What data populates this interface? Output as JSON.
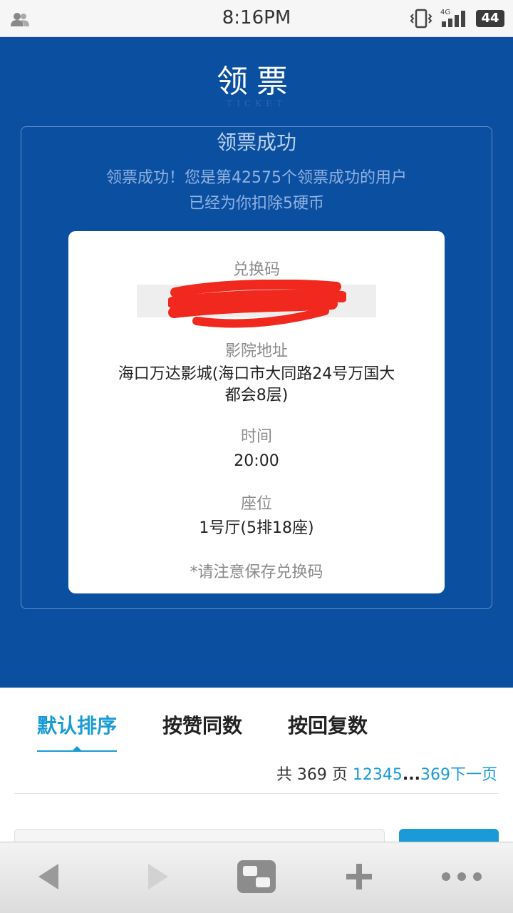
{
  "status_bar": {
    "time": "8:16PM",
    "network": "4G",
    "battery": "44"
  },
  "header": {
    "title": "领票",
    "subtitle": "TICKET"
  },
  "result": {
    "title": "领票成功",
    "message_line1": "领票成功！您是第42575个领票成功的用户",
    "message_line2": "已经为你扣除5硬币"
  },
  "ticket": {
    "code_label": "兑换码",
    "cinema_label": "影院地址",
    "cinema_line1": "海口万达影城(海口市大同路24号万国大",
    "cinema_line2": "都会8层)",
    "time_label": "时间",
    "time_value": "20:00",
    "seat_label": "座位",
    "seat_value": "1号厅(5排18座)",
    "note": "*请注意保存兑换码"
  },
  "tabs": [
    {
      "label": "默认排序",
      "active": true
    },
    {
      "label": "按赞同数",
      "active": false
    },
    {
      "label": "按回复数",
      "active": false
    }
  ],
  "pager": {
    "prefix": "共 369 页 ",
    "pages": "12345",
    "dots": "...",
    "last": "369",
    "next": "下一页"
  },
  "colors": {
    "brand_blue": "#0b4fa0",
    "accent": "#1a9bd6",
    "redaction": "#f0281e"
  },
  "icons": [
    "contacts-icon",
    "vibrate-icon",
    "signal-icon",
    "battery-icon",
    "back-icon",
    "forward-icon",
    "windows-icon",
    "add-icon",
    "more-icon"
  ]
}
